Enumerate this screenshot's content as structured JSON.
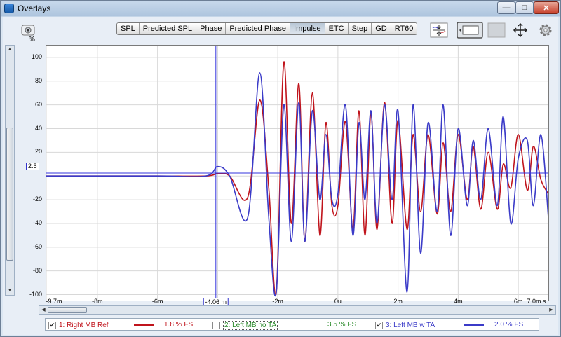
{
  "window": {
    "title": "Overlays"
  },
  "toolbar": {
    "tabs": [
      {
        "label": "SPL",
        "active": false
      },
      {
        "label": "Predicted SPL",
        "active": false
      },
      {
        "label": "Phase",
        "active": false
      },
      {
        "label": "Predicted Phase",
        "active": false
      },
      {
        "label": "Impulse",
        "active": true
      },
      {
        "label": "ETC",
        "active": false
      },
      {
        "label": "Step",
        "active": false
      },
      {
        "label": "GD",
        "active": false
      },
      {
        "label": "RT60",
        "active": false
      }
    ],
    "icons": [
      "capture-icon",
      "overlay-arrows-icon",
      "monitor-icon",
      "blank-panel-icon",
      "move-arrows-icon",
      "gear-icon"
    ]
  },
  "plot": {
    "y_unit": "%",
    "cursor_x_label": "-4.06 m",
    "cursor_y_label": "2.5",
    "colors": {
      "series1": "#c0141c",
      "series2": "#2a8a2a",
      "series3": "#3b3bc8",
      "cursor": "#3333dd",
      "grid": "#d8d8d8"
    }
  },
  "chart_data": {
    "type": "line",
    "title": "",
    "xlabel": "s",
    "ylabel": "%",
    "xlim": [
      -9.7,
      7.0
    ],
    "ylim": [
      -105,
      110
    ],
    "x_tick_labels": [
      "-9.7m",
      "-8m",
      "-6m",
      "-2m",
      "0u",
      "2m",
      "4m",
      "6m",
      "7.0m s"
    ],
    "y_tick_labels": [
      "100",
      "80",
      "60",
      "40",
      "20",
      "-20",
      "-40",
      "-60",
      "-80",
      "-100"
    ],
    "grid": true,
    "cursor": {
      "x": -4.06,
      "y": 2.5
    },
    "series": [
      {
        "name": "1: Right MB Ref",
        "x": [
          -9.7,
          -6.0,
          -4.4,
          -4.0,
          -3.6,
          -3.0,
          -2.6,
          -2.3,
          -2.05,
          -1.8,
          -1.55,
          -1.3,
          -1.1,
          -0.85,
          -0.6,
          -0.4,
          -0.2,
          0.0,
          0.25,
          0.5,
          0.7,
          0.9,
          1.1,
          1.3,
          1.55,
          1.8,
          2.0,
          2.3,
          2.5,
          2.75,
          3.0,
          3.3,
          3.5,
          3.75,
          4.0,
          4.3,
          4.5,
          4.75,
          5.0,
          5.3,
          5.5,
          5.75,
          6.0,
          6.3,
          6.5,
          6.75,
          7.0
        ],
        "y": [
          0,
          0,
          0,
          2,
          0,
          -18,
          64,
          -10,
          -98,
          96,
          -40,
          78,
          -55,
          70,
          -50,
          45,
          -25,
          -25,
          46,
          -45,
          55,
          -50,
          53,
          -45,
          62,
          -40,
          47,
          -45,
          35,
          -30,
          35,
          -32,
          28,
          -30,
          35,
          -20,
          25,
          -28,
          20,
          -28,
          10,
          -10,
          35,
          -12,
          25,
          -3,
          -15
        ]
      },
      {
        "name": "2: Left MB no TA",
        "visible": false,
        "x": [],
        "y": []
      },
      {
        "name": "3: Left MB w TA",
        "x": [
          -9.7,
          -6.0,
          -4.4,
          -4.0,
          -3.6,
          -3.0,
          -2.6,
          -2.3,
          -2.05,
          -1.8,
          -1.55,
          -1.3,
          -1.1,
          -0.85,
          -0.6,
          -0.4,
          -0.2,
          0.0,
          0.25,
          0.5,
          0.7,
          0.9,
          1.1,
          1.3,
          1.55,
          1.8,
          2.0,
          2.3,
          2.5,
          2.75,
          3.0,
          3.3,
          3.5,
          3.75,
          4.0,
          4.3,
          4.5,
          4.75,
          5.0,
          5.3,
          5.5,
          5.75,
          6.0,
          6.3,
          6.5,
          6.75,
          7.0
        ],
        "y": [
          0,
          0,
          0,
          8,
          0,
          -35,
          87,
          -35,
          -98,
          60,
          -55,
          62,
          -55,
          55,
          -20,
          35,
          -20,
          -15,
          60,
          -50,
          45,
          -20,
          55,
          -40,
          60,
          -20,
          55,
          -98,
          60,
          -65,
          45,
          -30,
          60,
          -50,
          40,
          -25,
          30,
          -20,
          40,
          -25,
          50,
          -40,
          15,
          30,
          -25,
          35,
          -35
        ]
      }
    ]
  },
  "legend": {
    "items": [
      {
        "label": "1: Right MB Ref",
        "checked": true,
        "fs": "1.8 % FS",
        "color": "#c0141c"
      },
      {
        "label": "2: Left MB no TA",
        "checked": false,
        "fs": "3.5 % FS",
        "color": "#2a8a2a"
      },
      {
        "label": "3: Left MB w TA",
        "checked": true,
        "fs": "2.0 % FS",
        "color": "#3b3bc8"
      }
    ]
  }
}
